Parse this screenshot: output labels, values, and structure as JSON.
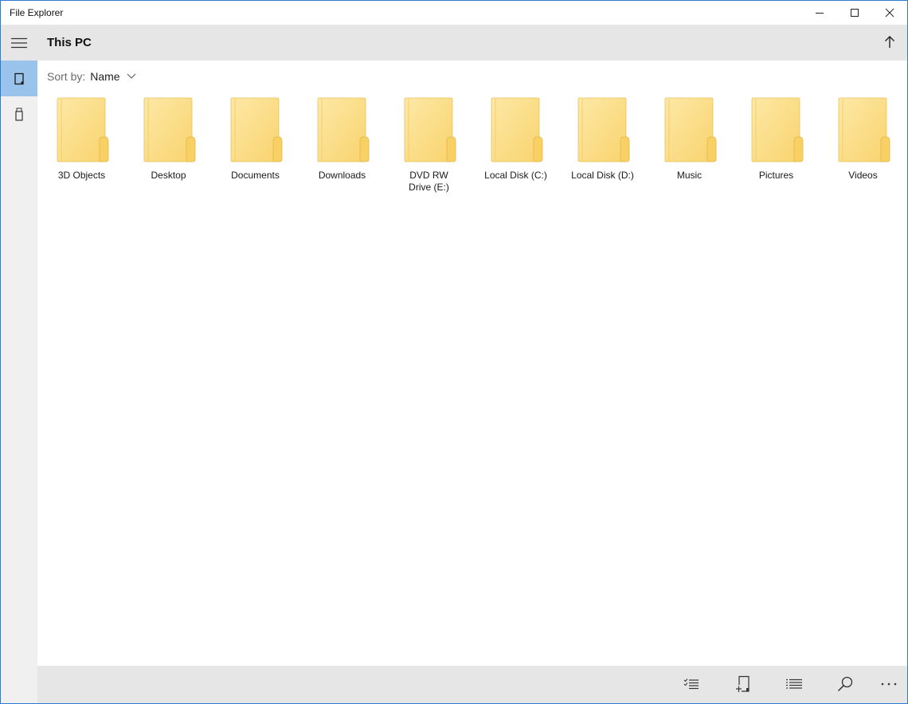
{
  "window": {
    "title": "File Explorer",
    "controls": {
      "minimize": "minimize",
      "maximize": "maximize",
      "close": "close"
    },
    "accent_color": "#2b7bd3"
  },
  "sidebar": {
    "menu_icon": "hamburger-icon",
    "items": [
      {
        "name": "this-pc",
        "icon": "device-icon",
        "active": true
      },
      {
        "name": "usb-drive",
        "icon": "usb-drive-icon",
        "active": false
      }
    ],
    "active_color": "#99c3ea"
  },
  "header": {
    "title": "This PC",
    "up_icon": "arrow-up-icon"
  },
  "sort": {
    "label": "Sort by:",
    "value": "Name"
  },
  "items": [
    {
      "label": "3D Objects"
    },
    {
      "label": "Desktop"
    },
    {
      "label": "Documents"
    },
    {
      "label": "Downloads"
    },
    {
      "label": "DVD RW Drive (E:)"
    },
    {
      "label": "Local Disk (C:)"
    },
    {
      "label": "Local Disk (D:)"
    },
    {
      "label": "Music"
    },
    {
      "label": "Pictures"
    },
    {
      "label": "Videos"
    }
  ],
  "bottom_toolbar": [
    {
      "name": "select",
      "icon": "checklist-icon"
    },
    {
      "name": "new-folder",
      "icon": "new-folder-icon"
    },
    {
      "name": "view",
      "icon": "list-view-icon"
    },
    {
      "name": "search",
      "icon": "search-icon"
    },
    {
      "name": "more",
      "icon": "more-icon"
    }
  ],
  "folder_color": "#fbd97a"
}
